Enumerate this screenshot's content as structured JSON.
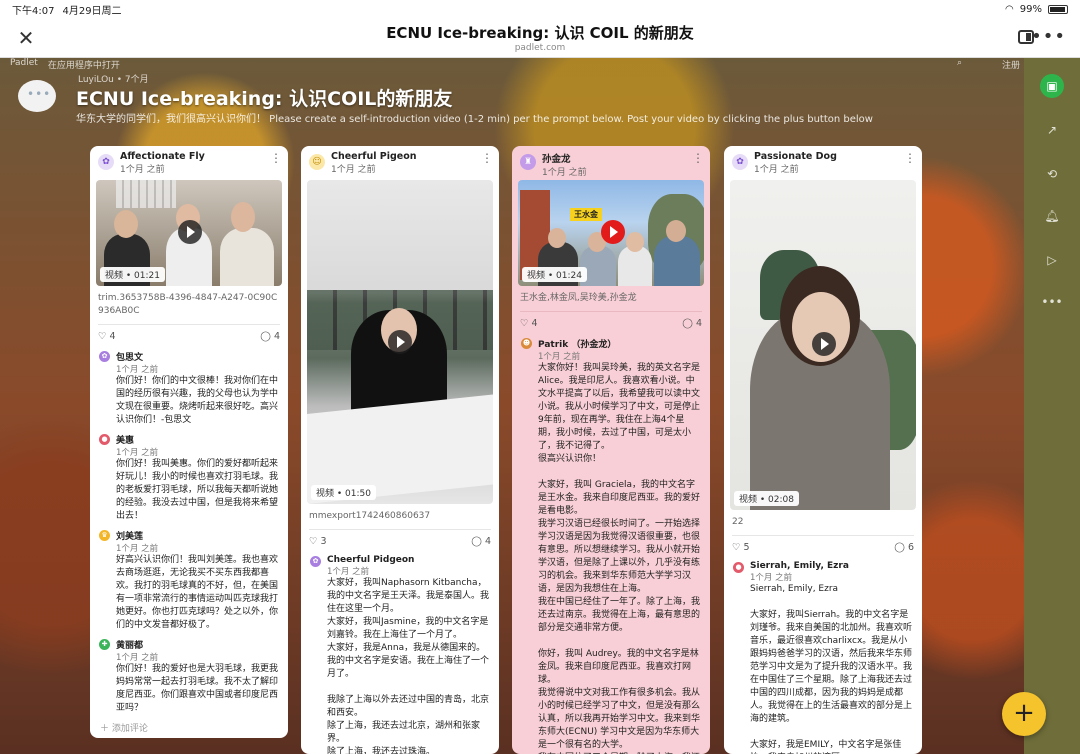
{
  "status": {
    "time": "下午4:07",
    "date": "4月29日周二",
    "battery": "99%"
  },
  "window": {
    "title": "ECNU Ice-breaking: 认识 COIL 的新朋友",
    "domain": "padlet.com"
  },
  "nav": {
    "left1": "Padlet",
    "left2": "在应用程序中打开",
    "right": "注册"
  },
  "board": {
    "meta": "LuyiLOu • 7个月",
    "title": "ECNU Ice-breaking: 认识COIL的新朋友",
    "desc": "华东大学的同学们，我们很高兴认识你们！ Please create a self-introduction video (1-2 min) per the prompt below. Post your video by clicking the plus button below"
  },
  "columns": [
    {
      "author": "Affectionate Fly",
      "time": "1个月 之前",
      "video_label": "视频 • 01:21",
      "caption": "trim.3653758B-4396-4847-A247-0C90C936AB0C",
      "likes": "4",
      "comments_count": "4",
      "comments": [
        {
          "name": "包思文",
          "time": "1个月 之前",
          "text": "你们好！你们的中文很棒！我对你们在中国的经历很有兴趣，我的父母也认为学中文现在很重要。烧烤听起来很好吃。高兴认识你们！-包思文"
        },
        {
          "name": "美惠",
          "time": "1个月 之前",
          "text": "你们好！我叫美惠。你们的爱好都听起来好玩儿！我小的时候也喜欢打羽毛球。我的老板爱打羽毛球，所以我每天都听说她的经验。我没去过中国，但是我将来希望出去！"
        },
        {
          "name": "刘美莲",
          "time": "1个月 之前",
          "text": "好高兴认识你们！我叫刘美莲。我也喜欢去商场逛逛，无论我买不买东西我都喜欢。我打的羽毛球真的不好，但，在美国有一项非常流行的事情运动叫匹克球我打她更好。你也打匹克球吗？处之以外，你们的中文发音都好极了。"
        },
        {
          "name": "黄丽都",
          "time": "1个月 之前",
          "text": "你们好！我的爱好也是大羽毛球，我更我妈妈常常一起去打羽毛球。我不太了解印度尼西亚。你们跟喜欢中国或者印度尼西亚吗？"
        }
      ],
      "add_comment": "添加评论"
    },
    {
      "author": "Cheerful Pigeon",
      "time": "1个月 之前",
      "video_label": "视频 • 01:50",
      "caption": "mmexport1742460860637",
      "likes": "3",
      "comments_count": "4",
      "comments": [
        {
          "name": "Cheerful Pidgeon",
          "time": "1个月 之前",
          "text": "大家好，我叫Naphasorn Kitbancha，我的中文名字是王天泽。我是泰国人。我住在这里一个月。\n大家好，我叫Jasmine，我的中文名字是刘嘉铃。我在上海住了一个月了。\n大家好，我是Anna，我是从德国来的。我的中文名字是安语。我在上海住了一个月了。\n\n我除了上海以外去还过中国的青岛，北京和西安。\n除了上海，我还去过北京，湖州和张家界。\n除了上海，我还去过珠海。"
        }
      ]
    },
    {
      "author": "孙金龙",
      "time": "1个月 之前",
      "video_label": "视频 • 01:24",
      "sign": "王水金",
      "caption": "王水金,林金凤,吴玲美,孙金龙",
      "likes": "4",
      "comments_count": "4",
      "comments": [
        {
          "name": "Patrik （孙金龙）",
          "time": "1个月 之前",
          "text": "大家你好！我叫吴玲美，我的英文名字是Alice。我是印尼人。我喜欢看小说。中文水平提高了以后，我希望我可以读中文小说。我从小时候学习了中文，可是停止9年前，现在再学。我住在上海4个星期，我小时候，去过了中国，可是太小了，我不记得了。\n很高兴认识你！\n\n大家好，我叫 Graciela，我的中文名字是王水金。我来自印度尼西亚。我的爱好是看电影。\n我学习汉语已经很长时间了。一开始选择学习汉语是因为我觉得汉语很重要，也很有意思。所以想继续学习。我从小就开始学汉语，但是除了上课以外，几乎没有练习的机会。我来到华东师范大学学习汉语，是因为我想住在上海。\n我在中国已经住了一年了。除了上海，我还去过南京。我觉得在上海，最有意思的部分是交通非常方便。\n\n你好，我叫 Audrey。我的中文名字是林金凤。我来自印度尼西亚。我喜欢打网球。\n我觉得说中文对我工作有很多机会。我从小的时候已经学习了中文，但是没有那么认真，所以我再开始学习中文。我来到华东师大(ECNU) 学习中文是因为华东师大是一个很有名的大学。\n我在中国住了三个星期。除了上海，我还去过苏州。"
        }
      ]
    },
    {
      "author": "Passionate Dog",
      "time": "1个月 之前",
      "video_label": "视频 • 02:08",
      "caption": "22",
      "likes": "5",
      "comments_count": "6",
      "comments": [
        {
          "name": "Sierrah, Emily, Ezra",
          "time": "1个月 之前",
          "text": "Sierrah, Emily, Ezra\n\n大家好，我叫Sierrah。我的中文名字是刘瑾爷。我来自美国的北加州。我喜欢听音乐，最近很喜欢charlixcx。我是从小跟妈妈爸爸学习的汉语，然后我来华东师范学习中文是为了提升我的汉语水平。我在中国住了三个星期。除了上海我还去过中国的四川成都，因为我的妈妈是成都人。我觉得在上的生活最喜欢的部分是上海的建筑。\n\n大家好，我是EMILY，中文名字是张佳怡。我来自加州的湾区。"
        }
      ]
    }
  ]
}
